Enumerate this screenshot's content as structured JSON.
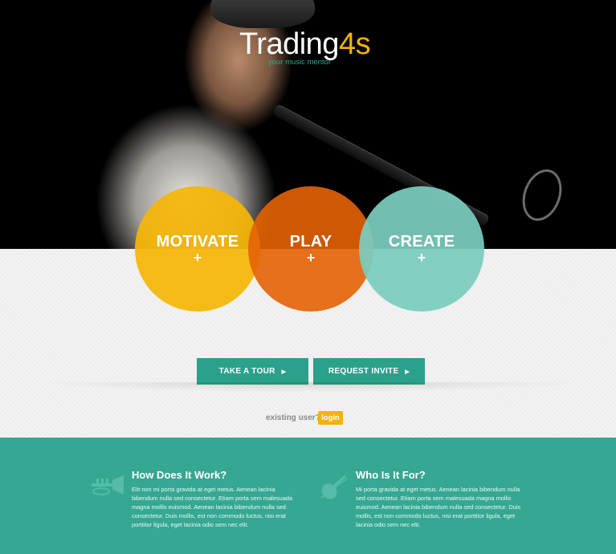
{
  "brand": {
    "name_main": "Trading",
    "name_accent": "4s",
    "tagline": "your music mentor"
  },
  "circles": [
    {
      "title": "MOTIVATE",
      "plus": "+"
    },
    {
      "title": "PLAY",
      "plus": "+"
    },
    {
      "title": "CREATE",
      "plus": "+"
    }
  ],
  "buttons": {
    "tour": "TAKE A TOUR",
    "invite": "REQUEST INVITE",
    "arrow": "▶"
  },
  "login": {
    "prompt": "existing user?",
    "label": "login"
  },
  "footer": {
    "col1": {
      "icon": "trumpet-icon",
      "title": "How Does It Work?",
      "body": "Elit non mi porta gravida at eget metus. Aenean lacinia bibendum nulla sed consectetur. Etiam porta sem malesuada magna mollis euismod. Aenean lacinia bibendum nulla sed consectetur. Duis mollis, est non commodo luctus, nisi erat porttitor ligula, eget lacinia odio sem nec elit."
    },
    "col2": {
      "icon": "violin-icon",
      "title": "Who Is It For?",
      "body": "Mi porta gravida at eget metus. Aenean lacinia bibendum nulla sed consectetur. Etiam porta sem malesuada magna mollis euismod. Aenean lacinia bibendum nulla sed consectetur. Duis mollis, est non commodo luctus, nisi erat porttitor ligula, eget lacinia odio sem nec elit."
    }
  },
  "colors": {
    "yellow": "#f4b606",
    "orange": "#e46204",
    "mint": "#7accbe",
    "teal": "#35a792",
    "button": "#2ba18b"
  }
}
